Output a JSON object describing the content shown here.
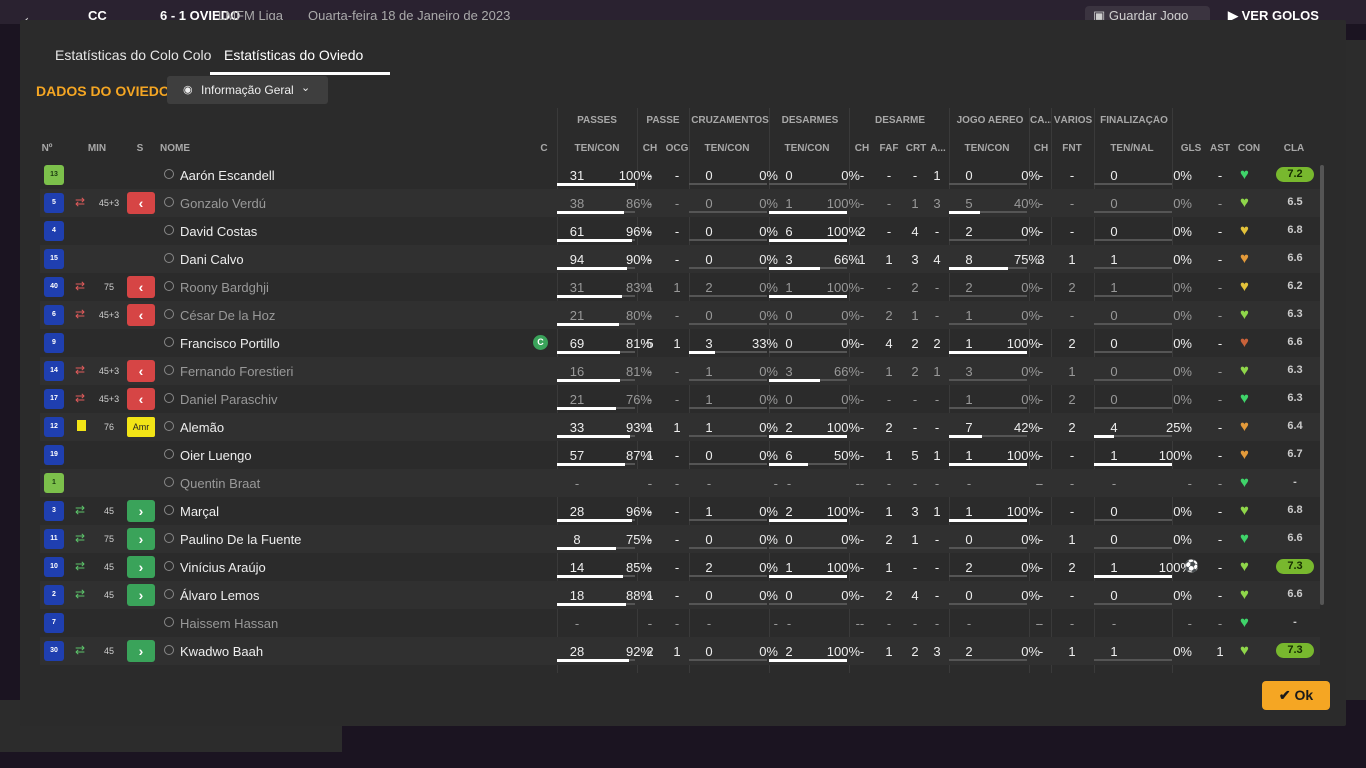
{
  "topbar": {
    "score_home": "CC",
    "score": "6 - 1",
    "away_team": "OVIEDO",
    "competition": "LMFM Liga",
    "date": "Quarta-feira 18 de Janeiro de 2023",
    "save_label": "Guardar Jogo",
    "play_label": "VER GOLOS"
  },
  "tabs": [
    {
      "label": "Estatísticas do Colo Colo"
    },
    {
      "label": "Estatísticas do Oviedo"
    }
  ],
  "section_title": "DADOS DO OVIEDO",
  "view_dropdown": {
    "selected": "Informação Geral"
  },
  "groups": [
    "PASSES",
    "PASSE",
    "CRUZAMENTOS",
    "DESARMES",
    "DESARME",
    "JOGO AÉREO",
    "CA...",
    "VÁRIOS",
    "FINALIZAÇÃO"
  ],
  "columns": {
    "num": "Nº",
    "min": "MIN",
    "s": "S",
    "name": "NOME",
    "c": "C",
    "passes": "TEN/CON",
    "passe_ch": "CH",
    "passe_ocg": "OCG",
    "cruz": "TEN/CON",
    "desarmes": "TEN/CON",
    "des_ch": "CH",
    "des_faf": "FAF",
    "des_crt": "CRT",
    "des_a": "A...",
    "aereo": "TEN/CON",
    "ca_ch": "CH",
    "var_fnt": "FNT",
    "fin": "TEN/NAL",
    "gls": "GLS",
    "ast": "AST",
    "con": "CON",
    "cla": "CLA"
  },
  "players": [
    {
      "num": "13",
      "gk": true,
      "sub": "",
      "min": "",
      "s": "",
      "name": "Aarón Escandell",
      "dim": false,
      "cap": "",
      "p_t": "31",
      "p_p": "100%",
      "p_f": 1.0,
      "ch": "-",
      "ocg": "-",
      "cr_t": "0",
      "cr_p": "0%",
      "cr_f": 0,
      "de_t": "0",
      "de_p": "0%",
      "de_f": 0,
      "d_ch": "-",
      "d_faf": "-",
      "d_crt": "-",
      "d_a": "1",
      "ae_t": "0",
      "ae_p": "0%",
      "ae_f": 0,
      "ca": "-",
      "fnt": "-",
      "fi_t": "0",
      "fi_p": "0%",
      "fi_f": 0,
      "gls": "",
      "ast": "-",
      "con": "#3fd46a",
      "cla": "7.2",
      "hi": true
    },
    {
      "num": "5",
      "gk": false,
      "sub": "off",
      "min": "45+3",
      "s": "off",
      "name": "Gonzalo Verdú",
      "dim": true,
      "cap": "",
      "p_t": "38",
      "p_p": "86%",
      "p_f": 0.86,
      "ch": "-",
      "ocg": "-",
      "cr_t": "0",
      "cr_p": "0%",
      "cr_f": 0,
      "de_t": "1",
      "de_p": "100%",
      "de_f": 1.0,
      "d_ch": "-",
      "d_faf": "-",
      "d_crt": "1",
      "d_a": "3",
      "ae_t": "5",
      "ae_p": "40%",
      "ae_f": 0.4,
      "ca": "-",
      "fnt": "-",
      "fi_t": "0",
      "fi_p": "0%",
      "fi_f": 0,
      "gls": "",
      "ast": "-",
      "con": "#8fd64a",
      "cla": "6.5",
      "hi": false
    },
    {
      "num": "4",
      "gk": false,
      "sub": "",
      "min": "",
      "s": "",
      "name": "David Costas",
      "dim": false,
      "cap": "",
      "p_t": "61",
      "p_p": "96%",
      "p_f": 0.96,
      "ch": "-",
      "ocg": "-",
      "cr_t": "0",
      "cr_p": "0%",
      "cr_f": 0,
      "de_t": "6",
      "de_p": "100%",
      "de_f": 1.0,
      "d_ch": "2",
      "d_faf": "-",
      "d_crt": "4",
      "d_a": "-",
      "ae_t": "2",
      "ae_p": "0%",
      "ae_f": 0,
      "ca": "-",
      "fnt": "-",
      "fi_t": "0",
      "fi_p": "0%",
      "fi_f": 0,
      "gls": "",
      "ast": "-",
      "con": "#e3c23a",
      "cla": "6.8",
      "hi": false
    },
    {
      "num": "15",
      "gk": false,
      "sub": "",
      "min": "",
      "s": "",
      "name": "Dani Calvo",
      "dim": false,
      "cap": "",
      "p_t": "94",
      "p_p": "90%",
      "p_f": 0.9,
      "ch": "-",
      "ocg": "-",
      "cr_t": "0",
      "cr_p": "0%",
      "cr_f": 0,
      "de_t": "3",
      "de_p": "66%",
      "de_f": 0.66,
      "d_ch": "1",
      "d_faf": "1",
      "d_crt": "3",
      "d_a": "4",
      "ae_t": "8",
      "ae_p": "75%",
      "ae_f": 0.75,
      "ca": "3",
      "fnt": "1",
      "fi_t": "1",
      "fi_p": "0%",
      "fi_f": 0,
      "gls": "",
      "ast": "-",
      "con": "#e39a3a",
      "cla": "6.6",
      "hi": false
    },
    {
      "num": "40",
      "gk": false,
      "sub": "off",
      "min": "75",
      "s": "off",
      "name": "Roony Bardghji",
      "dim": true,
      "cap": "",
      "p_t": "31",
      "p_p": "83%",
      "p_f": 0.83,
      "ch": "1",
      "ocg": "1",
      "cr_t": "2",
      "cr_p": "0%",
      "cr_f": 0,
      "de_t": "1",
      "de_p": "100%",
      "de_f": 1.0,
      "d_ch": "-",
      "d_faf": "-",
      "d_crt": "2",
      "d_a": "-",
      "ae_t": "2",
      "ae_p": "0%",
      "ae_f": 0,
      "ca": "-",
      "fnt": "2",
      "fi_t": "1",
      "fi_p": "0%",
      "fi_f": 0,
      "gls": "",
      "ast": "-",
      "con": "#e3c23a",
      "cla": "6.2",
      "hi": false
    },
    {
      "num": "6",
      "gk": false,
      "sub": "off",
      "min": "45+3",
      "s": "off",
      "name": "César De la Hoz",
      "dim": true,
      "cap": "",
      "p_t": "21",
      "p_p": "80%",
      "p_f": 0.8,
      "ch": "-",
      "ocg": "-",
      "cr_t": "0",
      "cr_p": "0%",
      "cr_f": 0,
      "de_t": "0",
      "de_p": "0%",
      "de_f": 0,
      "d_ch": "-",
      "d_faf": "2",
      "d_crt": "1",
      "d_a": "-",
      "ae_t": "1",
      "ae_p": "0%",
      "ae_f": 0,
      "ca": "-",
      "fnt": "-",
      "fi_t": "0",
      "fi_p": "0%",
      "fi_f": 0,
      "gls": "",
      "ast": "-",
      "con": "#8fd64a",
      "cla": "6.3",
      "hi": false
    },
    {
      "num": "9",
      "gk": false,
      "sub": "",
      "min": "",
      "s": "",
      "name": "Francisco Portillo",
      "dim": false,
      "cap": "C",
      "p_t": "69",
      "p_p": "81%",
      "p_f": 0.81,
      "ch": "5",
      "ocg": "1",
      "cr_t": "3",
      "cr_p": "33%",
      "cr_f": 0.33,
      "de_t": "0",
      "de_p": "0%",
      "de_f": 0,
      "d_ch": "-",
      "d_faf": "4",
      "d_crt": "2",
      "d_a": "2",
      "ae_t": "1",
      "ae_p": "100%",
      "ae_f": 1.0,
      "ca": "-",
      "fnt": "2",
      "fi_t": "0",
      "fi_p": "0%",
      "fi_f": 0,
      "gls": "",
      "ast": "-",
      "con": "#c9623a",
      "cla": "6.6",
      "hi": false
    },
    {
      "num": "14",
      "gk": false,
      "sub": "off",
      "min": "45+3",
      "s": "off",
      "name": "Fernando Forestieri",
      "dim": true,
      "cap": "",
      "p_t": "16",
      "p_p": "81%",
      "p_f": 0.81,
      "ch": "-",
      "ocg": "-",
      "cr_t": "1",
      "cr_p": "0%",
      "cr_f": 0,
      "de_t": "3",
      "de_p": "66%",
      "de_f": 0.66,
      "d_ch": "-",
      "d_faf": "1",
      "d_crt": "2",
      "d_a": "1",
      "ae_t": "3",
      "ae_p": "0%",
      "ae_f": 0,
      "ca": "-",
      "fnt": "1",
      "fi_t": "0",
      "fi_p": "0%",
      "fi_f": 0,
      "gls": "",
      "ast": "-",
      "con": "#8fd64a",
      "cla": "6.3",
      "hi": false
    },
    {
      "num": "17",
      "gk": false,
      "sub": "off",
      "min": "45+3",
      "s": "off",
      "name": "Daniel Paraschiv",
      "dim": true,
      "cap": "",
      "p_t": "21",
      "p_p": "76%",
      "p_f": 0.76,
      "ch": "-",
      "ocg": "-",
      "cr_t": "1",
      "cr_p": "0%",
      "cr_f": 0,
      "de_t": "0",
      "de_p": "0%",
      "de_f": 0,
      "d_ch": "-",
      "d_faf": "-",
      "d_crt": "-",
      "d_a": "-",
      "ae_t": "1",
      "ae_p": "0%",
      "ae_f": 0,
      "ca": "-",
      "fnt": "2",
      "fi_t": "0",
      "fi_p": "0%",
      "fi_f": 0,
      "gls": "",
      "ast": "-",
      "con": "#3fd46a",
      "cla": "6.3",
      "hi": false
    },
    {
      "num": "12",
      "gk": false,
      "sub": "card",
      "min": "76",
      "s": "amr",
      "name": "Alemão",
      "dim": false,
      "cap": "",
      "p_t": "33",
      "p_p": "93%",
      "p_f": 0.93,
      "ch": "1",
      "ocg": "1",
      "cr_t": "1",
      "cr_p": "0%",
      "cr_f": 0,
      "de_t": "2",
      "de_p": "100%",
      "de_f": 1.0,
      "d_ch": "-",
      "d_faf": "2",
      "d_crt": "-",
      "d_a": "-",
      "ae_t": "7",
      "ae_p": "42%",
      "ae_f": 0.42,
      "ca": "-",
      "fnt": "2",
      "fi_t": "4",
      "fi_p": "25%",
      "fi_f": 0.25,
      "gls": "",
      "ast": "-",
      "con": "#e39a3a",
      "cla": "6.4",
      "hi": false
    },
    {
      "num": "19",
      "gk": false,
      "sub": "",
      "min": "",
      "s": "",
      "name": "Oier Luengo",
      "dim": false,
      "cap": "",
      "p_t": "57",
      "p_p": "87%",
      "p_f": 0.87,
      "ch": "1",
      "ocg": "-",
      "cr_t": "0",
      "cr_p": "0%",
      "cr_f": 0,
      "de_t": "6",
      "de_p": "50%",
      "de_f": 0.5,
      "d_ch": "-",
      "d_faf": "1",
      "d_crt": "5",
      "d_a": "1",
      "ae_t": "1",
      "ae_p": "100%",
      "ae_f": 1.0,
      "ca": "-",
      "fnt": "-",
      "fi_t": "1",
      "fi_p": "100%",
      "fi_f": 1.0,
      "gls": "",
      "ast": "-",
      "con": "#e39a3a",
      "cla": "6.7",
      "hi": false
    },
    {
      "num": "1",
      "gk": true,
      "sub": "",
      "min": "",
      "s": "",
      "name": "Quentin Braat",
      "dim": true,
      "cap": "",
      "p_t": "-",
      "p_p": "-",
      "p_f": -1,
      "ch": "-",
      "ocg": "-",
      "cr_t": "-",
      "cr_p": "-",
      "cr_f": -1,
      "de_t": "-",
      "de_p": "-",
      "de_f": -1,
      "d_ch": "-",
      "d_faf": "-",
      "d_crt": "-",
      "d_a": "-",
      "ae_t": "-",
      "ae_p": "-",
      "ae_f": -1,
      "ca": "-",
      "fnt": "-",
      "fi_t": "-",
      "fi_p": "-",
      "fi_f": -1,
      "gls": "",
      "ast": "-",
      "con": "#3fd46a",
      "cla": "-",
      "hi": false
    },
    {
      "num": "3",
      "gk": false,
      "sub": "on",
      "min": "45",
      "s": "on",
      "name": "Marçal",
      "dim": false,
      "cap": "",
      "p_t": "28",
      "p_p": "96%",
      "p_f": 0.96,
      "ch": "-",
      "ocg": "-",
      "cr_t": "1",
      "cr_p": "0%",
      "cr_f": 0,
      "de_t": "2",
      "de_p": "100%",
      "de_f": 1.0,
      "d_ch": "-",
      "d_faf": "1",
      "d_crt": "3",
      "d_a": "1",
      "ae_t": "1",
      "ae_p": "100%",
      "ae_f": 1.0,
      "ca": "-",
      "fnt": "-",
      "fi_t": "0",
      "fi_p": "0%",
      "fi_f": 0,
      "gls": "",
      "ast": "-",
      "con": "#8fd64a",
      "cla": "6.8",
      "hi": false
    },
    {
      "num": "11",
      "gk": false,
      "sub": "on",
      "min": "75",
      "s": "on",
      "name": "Paulino De la Fuente",
      "dim": false,
      "cap": "",
      "p_t": "8",
      "p_p": "75%",
      "p_f": 0.75,
      "ch": "-",
      "ocg": "-",
      "cr_t": "0",
      "cr_p": "0%",
      "cr_f": 0,
      "de_t": "0",
      "de_p": "0%",
      "de_f": 0,
      "d_ch": "-",
      "d_faf": "2",
      "d_crt": "1",
      "d_a": "-",
      "ae_t": "0",
      "ae_p": "0%",
      "ae_f": 0,
      "ca": "-",
      "fnt": "1",
      "fi_t": "0",
      "fi_p": "0%",
      "fi_f": 0,
      "gls": "",
      "ast": "-",
      "con": "#3fd46a",
      "cla": "6.6",
      "hi": false
    },
    {
      "num": "10",
      "gk": false,
      "sub": "on",
      "min": "45",
      "s": "on",
      "name": "Vinícius Araújo",
      "dim": false,
      "cap": "",
      "p_t": "14",
      "p_p": "85%",
      "p_f": 0.85,
      "ch": "-",
      "ocg": "-",
      "cr_t": "2",
      "cr_p": "0%",
      "cr_f": 0,
      "de_t": "1",
      "de_p": "100%",
      "de_f": 1.0,
      "d_ch": "-",
      "d_faf": "1",
      "d_crt": "-",
      "d_a": "-",
      "ae_t": "2",
      "ae_p": "0%",
      "ae_f": 0,
      "ca": "-",
      "fnt": "2",
      "fi_t": "1",
      "fi_p": "100%",
      "fi_f": 1.0,
      "gls": "ball",
      "ast": "-",
      "con": "#8fd64a",
      "cla": "7.3",
      "hi": true
    },
    {
      "num": "2",
      "gk": false,
      "sub": "on",
      "min": "45",
      "s": "on",
      "name": "Álvaro Lemos",
      "dim": false,
      "cap": "",
      "p_t": "18",
      "p_p": "88%",
      "p_f": 0.88,
      "ch": "1",
      "ocg": "-",
      "cr_t": "0",
      "cr_p": "0%",
      "cr_f": 0,
      "de_t": "0",
      "de_p": "0%",
      "de_f": 0,
      "d_ch": "-",
      "d_faf": "2",
      "d_crt": "4",
      "d_a": "-",
      "ae_t": "0",
      "ae_p": "0%",
      "ae_f": 0,
      "ca": "-",
      "fnt": "-",
      "fi_t": "0",
      "fi_p": "0%",
      "fi_f": 0,
      "gls": "",
      "ast": "-",
      "con": "#8fd64a",
      "cla": "6.6",
      "hi": false
    },
    {
      "num": "7",
      "gk": false,
      "sub": "",
      "min": "",
      "s": "",
      "name": "Haissem Hassan",
      "dim": true,
      "cap": "",
      "p_t": "-",
      "p_p": "-",
      "p_f": -1,
      "ch": "-",
      "ocg": "-",
      "cr_t": "-",
      "cr_p": "-",
      "cr_f": -1,
      "de_t": "-",
      "de_p": "-",
      "de_f": -1,
      "d_ch": "-",
      "d_faf": "-",
      "d_crt": "-",
      "d_a": "-",
      "ae_t": "-",
      "ae_p": "-",
      "ae_f": -1,
      "ca": "-",
      "fnt": "-",
      "fi_t": "-",
      "fi_p": "-",
      "fi_f": -1,
      "gls": "",
      "ast": "-",
      "con": "#3fd46a",
      "cla": "-",
      "hi": false
    },
    {
      "num": "30",
      "gk": false,
      "sub": "on",
      "min": "45",
      "s": "on",
      "name": "Kwadwo Baah",
      "dim": false,
      "cap": "",
      "p_t": "28",
      "p_p": "92%",
      "p_f": 0.92,
      "ch": "2",
      "ocg": "1",
      "cr_t": "0",
      "cr_p": "0%",
      "cr_f": 0,
      "de_t": "2",
      "de_p": "100%",
      "de_f": 1.0,
      "d_ch": "-",
      "d_faf": "1",
      "d_crt": "2",
      "d_a": "3",
      "ae_t": "2",
      "ae_p": "0%",
      "ae_f": 0,
      "ca": "-",
      "fnt": "1",
      "fi_t": "1",
      "fi_p": "0%",
      "fi_f": 0,
      "gls": "",
      "ast": "1",
      "con": "#8fd64a",
      "cla": "7.3",
      "hi": true
    }
  ],
  "ok_label": "Ok",
  "colors": {
    "accent": "#f5a623",
    "good": "#78b82e",
    "sub_off": "#d64545",
    "sub_on": "#3aa35a"
  }
}
